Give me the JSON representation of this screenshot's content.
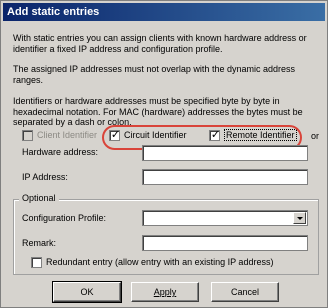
{
  "window": {
    "title": "Add static entries"
  },
  "intro": {
    "p1": "With static entries you can assign clients with known hardware address or identifier a fixed IP address and configuration profile.",
    "p2": "The assigned IP addresses must not overlap with the dynamic address ranges.",
    "p3": "Identifiers or hardware addresses must be specified byte by byte in hexadecimal notation. For MAC (hardware) addresses the bytes must be separated by a dash or colon."
  },
  "identifiers": {
    "client_identifier": {
      "label": "Client Identifier",
      "checked": false,
      "enabled": false
    },
    "circuit_identifier": {
      "label": "Circuit Identifier",
      "checked": true
    },
    "remote_identifier": {
      "label": "Remote Identifier",
      "checked": true
    },
    "or_label": "or",
    "highlight_color": "#d9443a"
  },
  "fields": {
    "hardware_address": {
      "label": "Hardware address:",
      "value": ""
    },
    "ip_address": {
      "label": "IP Address:",
      "value": ""
    }
  },
  "optional": {
    "group_title": "Optional",
    "configuration_profile": {
      "label": "Configuration Profile:",
      "value": ""
    },
    "remark": {
      "label": "Remark:",
      "value": ""
    },
    "redundant_entry": {
      "label": "Redundant entry (allow entry with an existing IP address)",
      "checked": false
    }
  },
  "buttons": {
    "ok": "OK",
    "apply": "Apply",
    "cancel": "Cancel"
  },
  "colors": {
    "dialog_bg": "#d6d3ce",
    "title_bar": "#0a246a"
  }
}
